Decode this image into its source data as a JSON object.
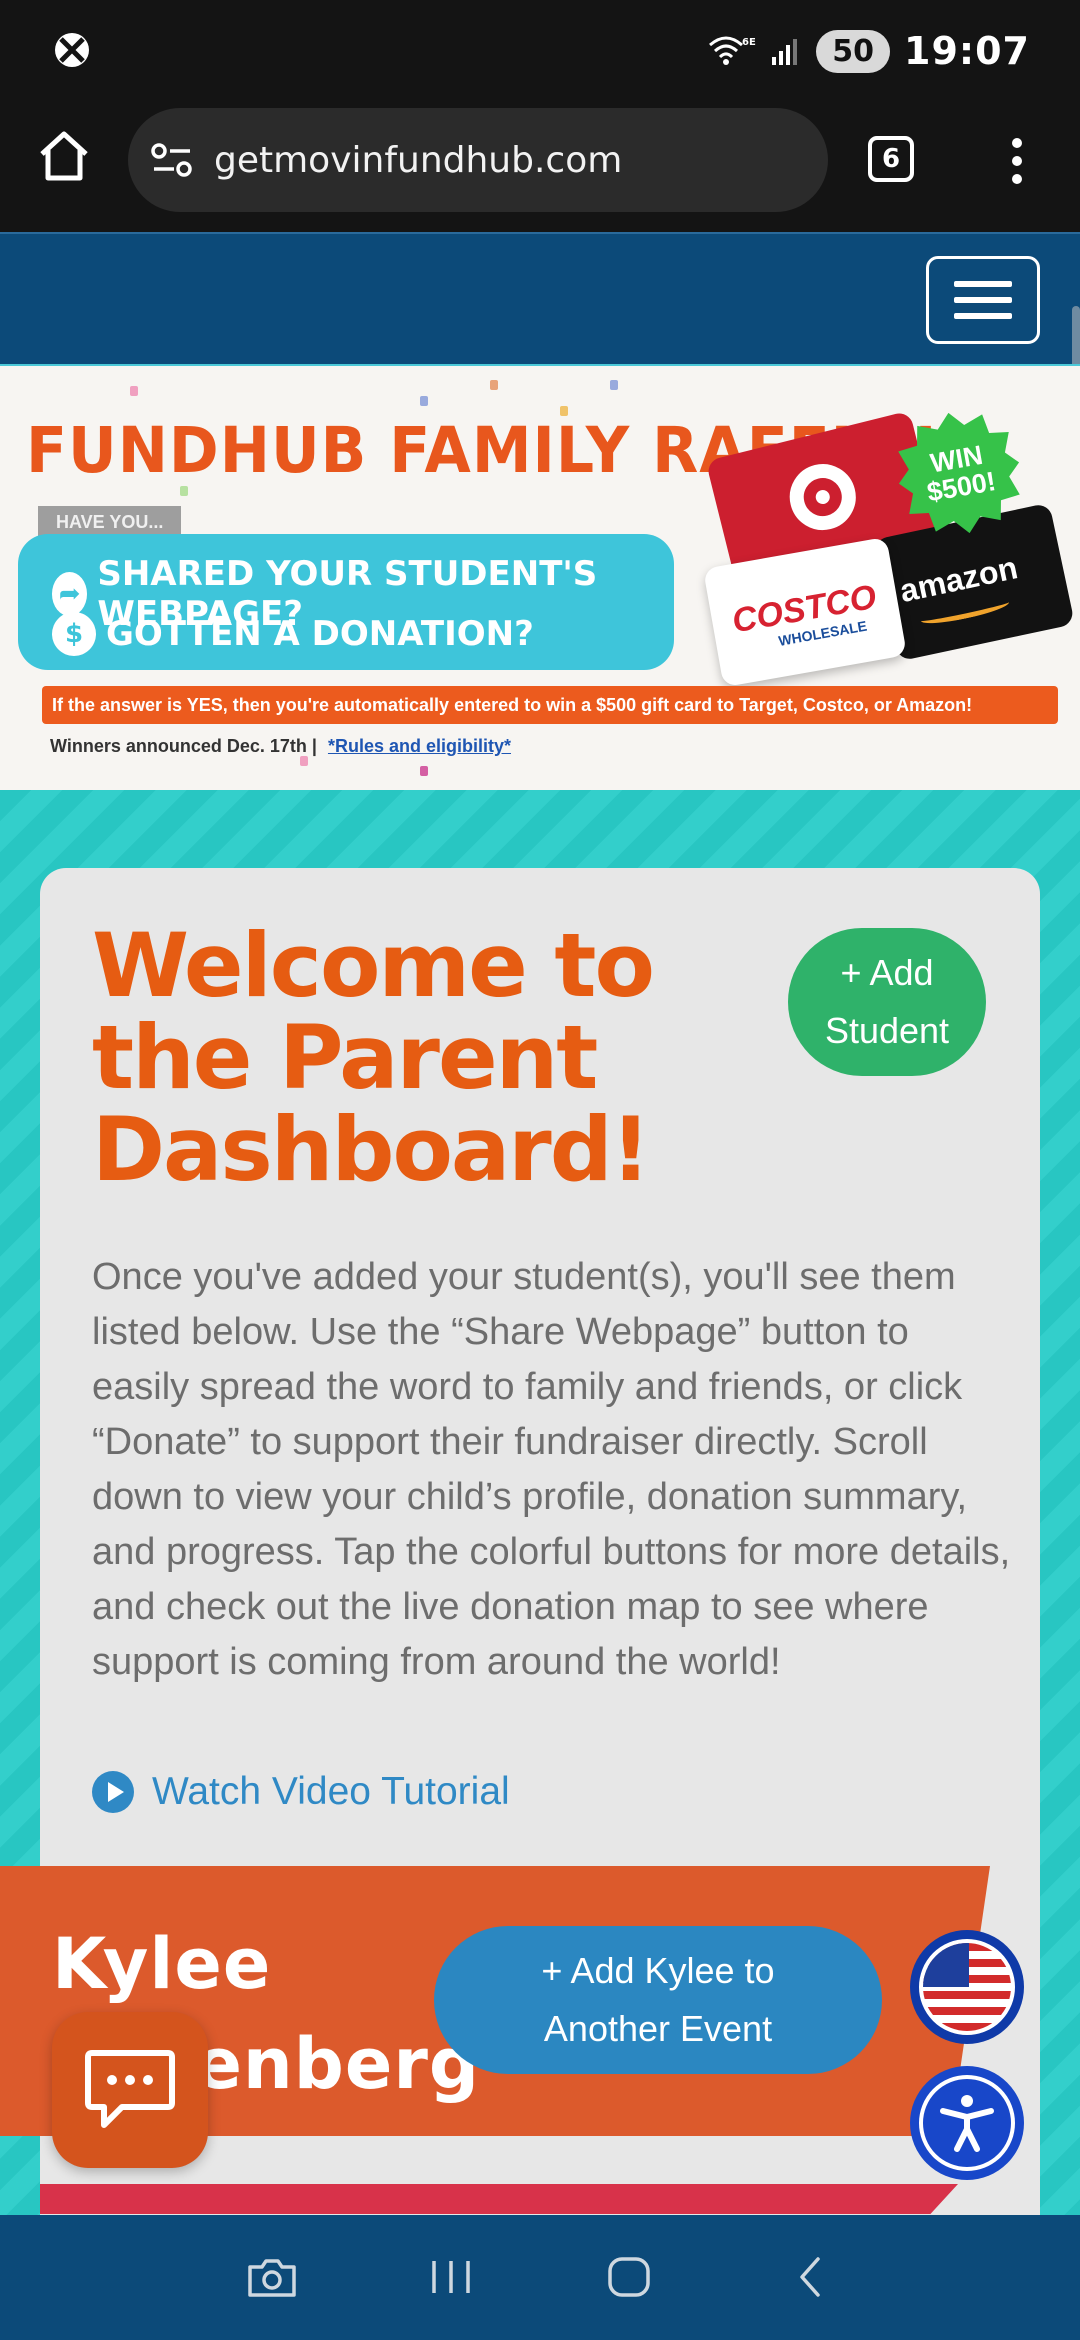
{
  "status_bar": {
    "battery": "50",
    "time": "19:07",
    "icons": [
      "xbox-icon",
      "wifi-6e-icon",
      "signal-icon"
    ]
  },
  "browser": {
    "url": "getmovinfundhub.com",
    "tab_count": "6",
    "icons": [
      "home-icon",
      "site-settings-icon",
      "more-menu-icon"
    ]
  },
  "raffle": {
    "title": "FUNDHUB FAMILY RAFFLE!",
    "have_you": "HAVE YOU...",
    "question_1": "SHARED YOUR STUDENT'S WEBPAGE?",
    "question_2": "GOTTEN A DONATION?",
    "win_line1": "WIN",
    "win_line2": "$500!",
    "card_costco": "COSTCO",
    "card_costco_sub": "WHOLESALE",
    "card_amazon": "amazon",
    "strip_text": "If the answer is YES, then you're automatically entered to win a $500 gift card to Target, Costco, or Amazon!",
    "footer_text": "Winners announced Dec. 17th  |",
    "footer_link": "*Rules and eligibility*"
  },
  "welcome": {
    "title": "Welcome to the Parent Dashboard!",
    "add_student_line1": "+ Add",
    "add_student_line2": "Student",
    "body": "Once you've added your student(s), you'll see them listed below. Use the “Share Webpage” button to easily spread the word to family and friends, or click “Donate” to support their fundraiser directly. Scroll down to view your child’s profile, donation summary, and progress. Tap the colorful buttons for more details, and check out the live donation map to see where support is coming from around the world!",
    "tutorial_link": "Watch Video Tutorial"
  },
  "student": {
    "name_line1": "Kylee",
    "name_line2": "Greenberg",
    "add_event_line1": "+ Add Kylee to",
    "add_event_line2": "Another Event"
  },
  "colors": {
    "nav_blue": "#0c4a79",
    "teal": "#28c6c2",
    "orange": "#e65c12",
    "green": "#2fb26a",
    "button_blue": "#2b87c1"
  }
}
